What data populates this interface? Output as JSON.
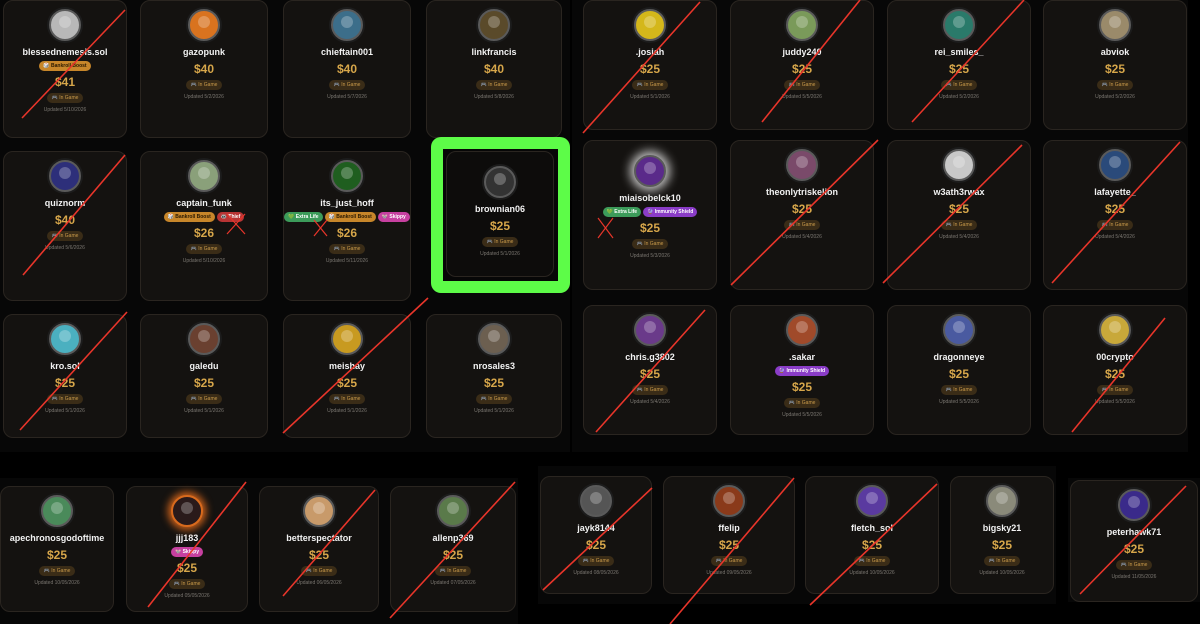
{
  "status_label": "🎮 In Game",
  "colors": {
    "accent_price": "#d6a64a",
    "highlight": "#5dfc48",
    "strike": "#e8352a"
  },
  "cards": [
    {
      "id": "c1",
      "username": "blessednemesis.sol",
      "price": "$41",
      "updated": "Updated 5/10/2026",
      "badges": [
        {
          "label": "🎲 Bankroll Boost",
          "type": "bankroll"
        }
      ],
      "struck": true
    },
    {
      "id": "c2",
      "username": "gazopunk",
      "price": "$40",
      "updated": "Updated 5/2/2026",
      "badges": [],
      "struck": false
    },
    {
      "id": "c3",
      "username": "chieftain001",
      "price": "$40",
      "updated": "Updated 5/7/2026",
      "badges": [],
      "struck": false
    },
    {
      "id": "c4",
      "username": "linkfrancis",
      "price": "$40",
      "updated": "Updated 5/8/2026",
      "badges": [],
      "struck": false
    },
    {
      "id": "c5",
      "username": "quiznorm",
      "price": "$40",
      "updated": "Updated 5/6/2026",
      "badges": [],
      "struck": true
    },
    {
      "id": "c6",
      "username": "captain_funk",
      "price": "$26",
      "updated": "Updated 5/10/2026",
      "badges": [
        {
          "label": "🎲 Bankroll Boost",
          "type": "bankroll"
        },
        {
          "label": "🦝 Thief",
          "type": "thief"
        }
      ],
      "struck": false
    },
    {
      "id": "c7",
      "username": "its_just_hoff",
      "price": "$26",
      "updated": "Updated 5/11/2026",
      "badges": [
        {
          "label": "💚 Extra Life",
          "type": "extra"
        },
        {
          "label": "🎲 Bankroll Boost",
          "type": "bankroll"
        },
        {
          "label": "🐭 Skippy",
          "type": "skippy"
        }
      ],
      "struck": false
    },
    {
      "id": "c8",
      "username": "brownian06",
      "price": "$25",
      "updated": "Updated 5/1/2026",
      "badges": [],
      "struck": false
    },
    {
      "id": "c9",
      "username": "kro.sol",
      "price": "$25",
      "updated": "Updated 5/1/2026",
      "badges": [],
      "struck": true
    },
    {
      "id": "c10",
      "username": "galedu",
      "price": "$25",
      "updated": "Updated 5/1/2026",
      "badges": [],
      "struck": false
    },
    {
      "id": "c11",
      "username": "meishay",
      "price": "$25",
      "updated": "Updated 5/1/2026",
      "badges": [],
      "struck": true
    },
    {
      "id": "c12",
      "username": "nrosales3",
      "price": "$25",
      "updated": "Updated 5/1/2026",
      "badges": [],
      "struck": false
    },
    {
      "id": "c13",
      "username": ".josiah",
      "price": "$25",
      "updated": "Updated 5/1/2026",
      "badges": [],
      "struck": true
    },
    {
      "id": "c14",
      "username": "juddy240",
      "price": "$25",
      "updated": "Updated 5/5/2026",
      "badges": [],
      "struck": true
    },
    {
      "id": "c15",
      "username": "rei_smiles_",
      "price": "$25",
      "updated": "Updated 5/2/2026",
      "badges": [],
      "struck": true
    },
    {
      "id": "c16",
      "username": "abviok",
      "price": "$25",
      "updated": "Updated 5/2/2026",
      "badges": [],
      "struck": false
    },
    {
      "id": "c17",
      "username": "miaisobelck10",
      "price": "$25",
      "updated": "Updated 5/3/2026",
      "badges": [
        {
          "label": "💚 Extra Life",
          "type": "extra"
        },
        {
          "label": "🔮 Immunity Shield",
          "type": "shield"
        }
      ],
      "struck": false
    },
    {
      "id": "c18",
      "username": "theonlytriskelion",
      "price": "$25",
      "updated": "Updated 5/4/2026",
      "badges": [],
      "struck": true
    },
    {
      "id": "c19",
      "username": "w3ath3rwax",
      "price": "$25",
      "updated": "Updated 5/4/2026",
      "badges": [],
      "struck": true
    },
    {
      "id": "c20",
      "username": "lafayette_",
      "price": "$25",
      "updated": "Updated 5/4/2026",
      "badges": [],
      "struck": true
    },
    {
      "id": "c21",
      "username": "chris.g3802",
      "price": "$25",
      "updated": "Updated 5/4/2026",
      "badges": [],
      "struck": true
    },
    {
      "id": "c22",
      "username": ".sakar",
      "price": "$25",
      "updated": "Updated 5/5/2026",
      "badges": [
        {
          "label": "🔮 Immunity Shield",
          "type": "shield"
        }
      ],
      "struck": false
    },
    {
      "id": "c23",
      "username": "dragonneye",
      "price": "$25",
      "updated": "Updated 5/5/2026",
      "badges": [],
      "struck": false
    },
    {
      "id": "c24",
      "username": "00crypto",
      "price": "$25",
      "updated": "Updated 5/5/2026",
      "badges": [],
      "struck": true
    },
    {
      "id": "c25",
      "username": "apechronosgodoftime",
      "price": "$25",
      "updated": "Updated 10/05/2026",
      "badges": [],
      "struck": false
    },
    {
      "id": "c26",
      "username": "jjj183",
      "price": "$25",
      "updated": "Updated 05/05/2026",
      "badges": [
        {
          "label": "🐭 Skippy",
          "type": "skippy"
        }
      ],
      "struck": true
    },
    {
      "id": "c27",
      "username": "betterspectator",
      "price": "$25",
      "updated": "Updated 06/05/2026",
      "badges": [],
      "struck": true
    },
    {
      "id": "c28",
      "username": "allenp369",
      "price": "$25",
      "updated": "Updated 07/05/2026",
      "badges": [],
      "struck": true
    },
    {
      "id": "c29",
      "username": "jayk8144",
      "price": "$25",
      "updated": "Updated 08/05/2026",
      "badges": [],
      "struck": true
    },
    {
      "id": "c30",
      "username": "ffelip",
      "price": "$25",
      "updated": "Updated 09/05/2026",
      "badges": [],
      "struck": true
    },
    {
      "id": "c31",
      "username": "fletch_sol",
      "price": "$25",
      "updated": "Updated 10/05/2026",
      "badges": [],
      "struck": true
    },
    {
      "id": "c32",
      "username": "bigsky21",
      "price": "$25",
      "updated": "Updated 10/05/2026",
      "badges": [],
      "struck": false
    },
    {
      "id": "c33",
      "username": "peterhawk71",
      "price": "$25",
      "updated": "Updated 11/05/2026",
      "badges": [],
      "struck": true
    }
  ]
}
